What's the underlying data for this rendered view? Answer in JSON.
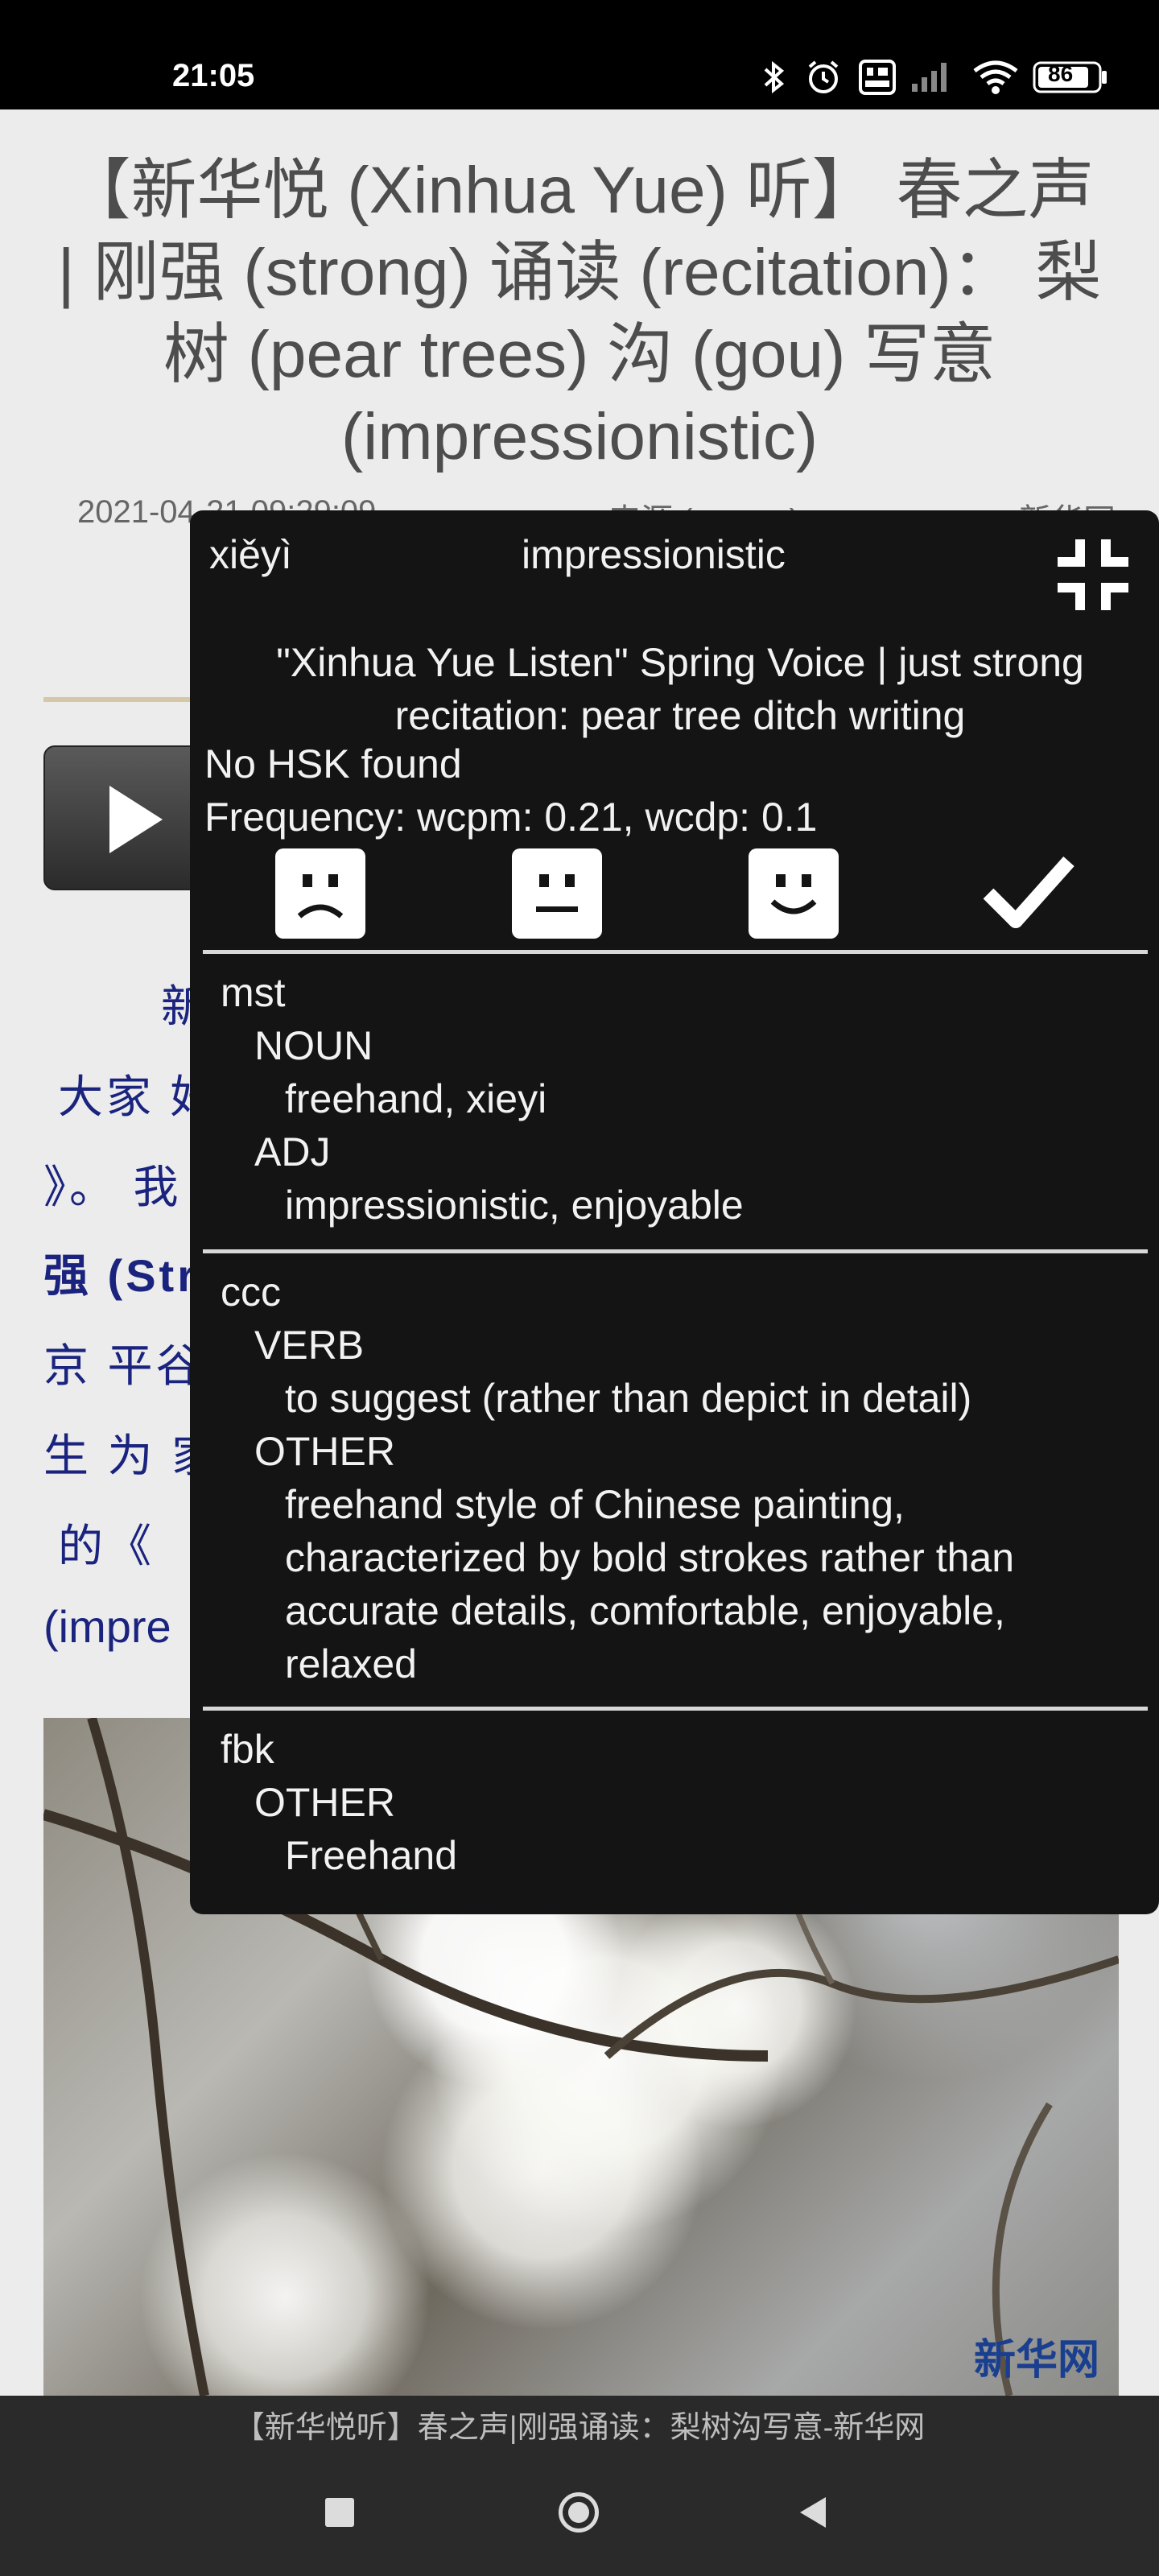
{
  "status_bar": {
    "time": "21:05",
    "battery": "86",
    "icons": [
      "bluetooth-icon",
      "alarm-icon",
      "volte-icon",
      "signal-icon",
      "wifi-icon",
      "battery-icon"
    ]
  },
  "article": {
    "title": "【新华悦 (Xinhua Yue) 听】 春之声 | 刚强 (strong) 诵读 (recitation)： 梨树 (pear trees) 沟 (gou) 写意 (impressionistic)",
    "date": "2021-04-21 09:29:09",
    "source": "来源 (source)：",
    "site": "新华网",
    "body_lines": [
      "新",
      "大家 好",
      "》。 我",
      "强 (Str",
      "京 平谷",
      "生 为 家",
      "的《",
      "(impre"
    ],
    "photo_watermark": "新华网"
  },
  "caption_bar": {
    "text": "【新华悦听】春之声|刚强诵读：梨树沟写意-新华网"
  },
  "dict_popup": {
    "pinyin": "xiěyì",
    "headword": "impressionistic",
    "translation": "\"Xinhua Yue Listen\" Spring Voice | just strong recitation: pear tree ditch writing",
    "hsk": "No HSK found",
    "frequency": "Frequency: wcpm: 0.21, wcdp: 0.1",
    "entries": [
      {
        "source": "mst",
        "groups": [
          {
            "pos": "NOUN",
            "definition": "freehand, xieyi"
          },
          {
            "pos": "ADJ",
            "definition": "impressionistic, enjoyable"
          }
        ]
      },
      {
        "source": "ccc",
        "groups": [
          {
            "pos": "VERB",
            "definition": "to suggest (rather than depict in detail)"
          },
          {
            "pos": "OTHER",
            "definition": "freehand style of Chinese painting, characterized by bold strokes rather than accurate details, comfortable, enjoyable, relaxed"
          }
        ]
      },
      {
        "source": "fbk",
        "groups": [
          {
            "pos": "OTHER",
            "definition": "Freehand"
          }
        ]
      }
    ]
  },
  "colors": {
    "popup_background": "#141414",
    "article_link_text": "#1a237e",
    "title_text": "#4d4d4d"
  }
}
